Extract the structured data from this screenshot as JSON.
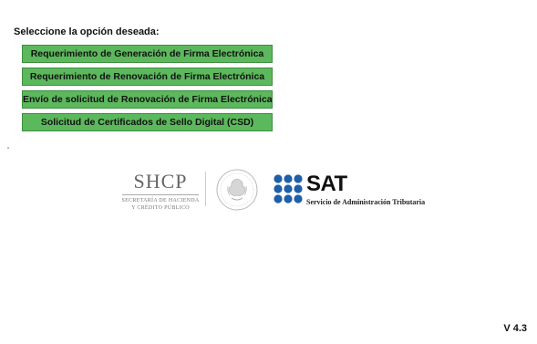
{
  "prompt": "Seleccione la opción deseada:",
  "options": [
    {
      "label": "Requerimiento de Generación de Firma Electrónica"
    },
    {
      "label": "Requerimiento de Renovación de Firma Electrónica"
    },
    {
      "label": "Envío de solicitud de Renovación de Firma Electrónica"
    },
    {
      "label": "Solicitud de Certificados de Sello Digital (CSD)"
    }
  ],
  "logos": {
    "shcp": {
      "title": "SHCP",
      "line1": "SECRETARÍA DE HACIENDA",
      "line2": "Y CRÉDITO PÚBLICO"
    },
    "seal_icon": "mexican-coat-of-arms-seal",
    "sat": {
      "title": "SAT",
      "subtitle": "Servicio de Administración Tributaria"
    }
  },
  "version": "V 4.3",
  "colors": {
    "button_green": "#5cb85c",
    "button_border": "#3e8e3e",
    "sat_blue": "#1f5ea8"
  }
}
